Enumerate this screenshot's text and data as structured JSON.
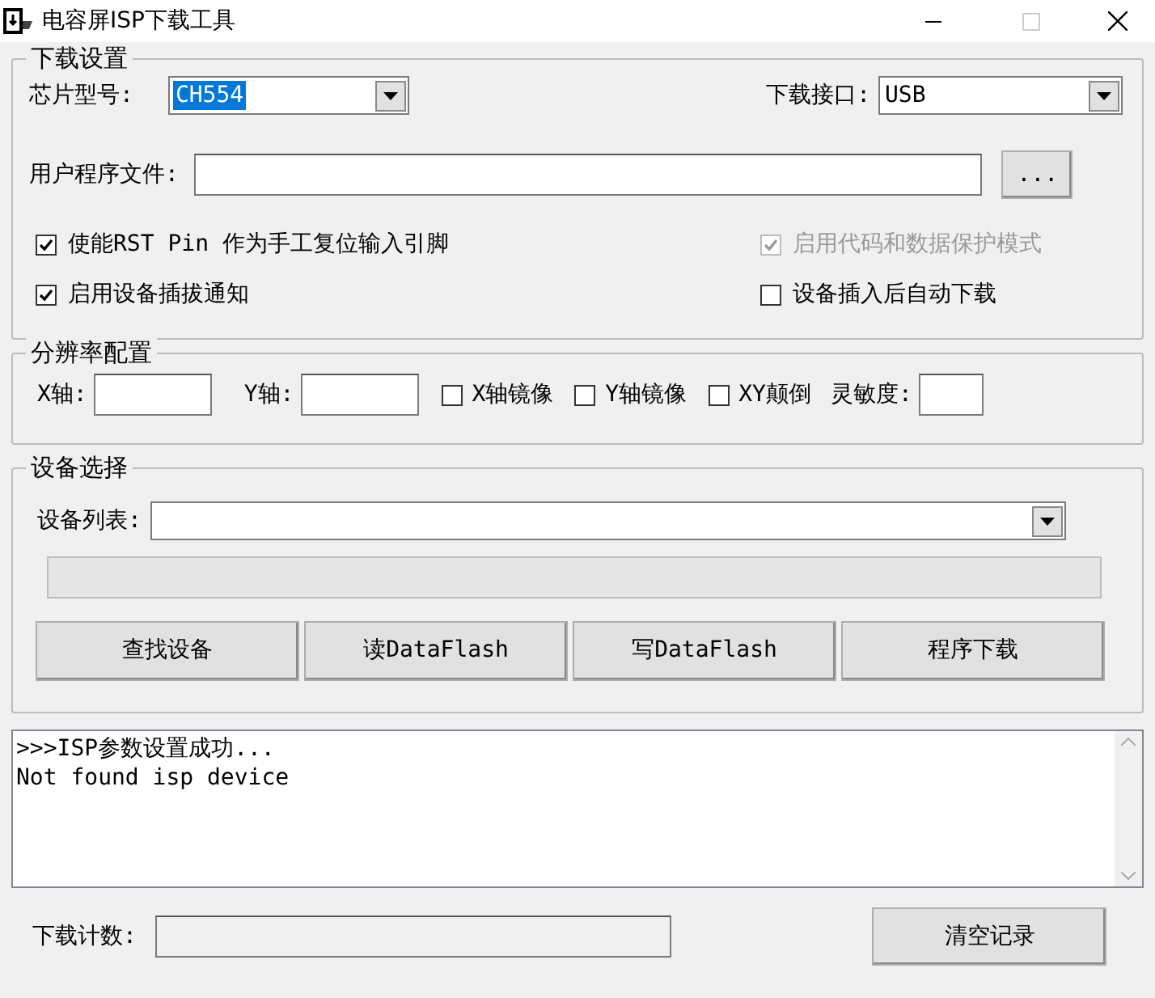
{
  "window": {
    "title": "电容屏ISP下载工具"
  },
  "download_settings": {
    "title": "下载设置",
    "chip_model": {
      "label": "芯片型号:",
      "value": "CH554",
      "highlighted": true
    },
    "interface": {
      "label": "下载接口:",
      "value": "USB",
      "highlighted": false
    },
    "user_file": {
      "label": "用户程序文件:",
      "browse": "..."
    },
    "options": [
      {
        "label": "使能RST Pin 作为手工复位输入引脚",
        "checked": true,
        "disabled": false
      },
      {
        "label": "启用代码和数据保护模式",
        "checked": true,
        "disabled": true
      },
      {
        "label": "启用设备插拔通知",
        "checked": true,
        "disabled": false
      },
      {
        "label": "设备插入后自动下载",
        "checked": false,
        "disabled": false
      }
    ]
  },
  "resolution": {
    "title": "分辨率配置",
    "x_label": "X轴:",
    "y_label": "Y轴:",
    "options": [
      {
        "label": "X轴镜像",
        "checked": false
      },
      {
        "label": "Y轴镜像",
        "checked": false
      },
      {
        "label": "XY颠倒",
        "checked": false
      }
    ],
    "sensitivity_label": "灵敏度:"
  },
  "device_selection": {
    "title": "设备选择",
    "list_label": "设备列表:",
    "progress": {
      "level": 0
    },
    "buttons": [
      "查找设备",
      "读DataFlash",
      "写DataFlash",
      "程序下载"
    ]
  },
  "log": {
    "lines": [
      ">>>ISP参数设置成功...",
      "Not found isp device"
    ]
  },
  "footer": {
    "count_label": "下载计数:",
    "clear_button": "清空记录"
  }
}
